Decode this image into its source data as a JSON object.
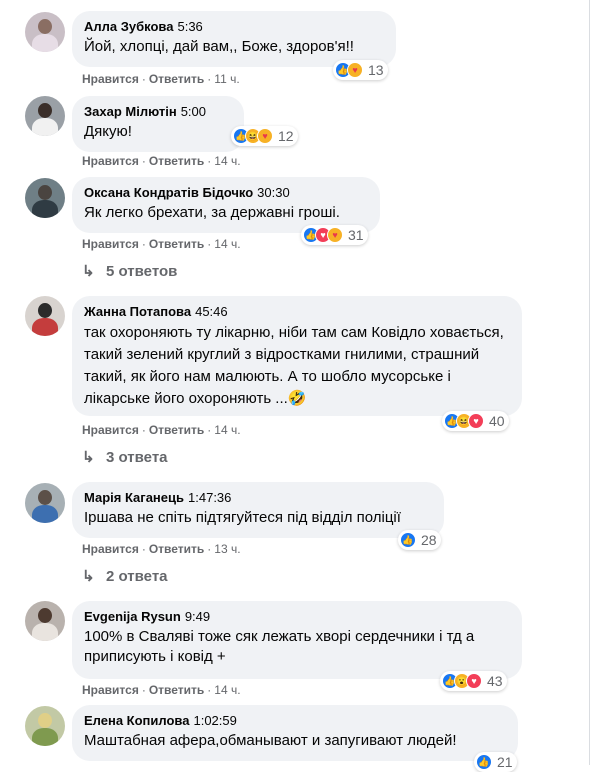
{
  "labels": {
    "like": "Нравится",
    "reply": "Ответить",
    "sep": "·"
  },
  "colors": {
    "bubble": "#f0f2f5",
    "muted": "#65676b",
    "like_blue": "#1877f2"
  },
  "comments": [
    {
      "author": "Алла Зубкова",
      "time": "5:36",
      "text": "Йой, хлопці, дай вам,, Боже, здоров'я!!",
      "age": "11 ч.",
      "reactions": [
        "like-icon",
        "care-icon"
      ],
      "reaction_count": "13"
    },
    {
      "author": "Захар Мілютін",
      "time": "5:00",
      "text": "Дякую!",
      "age": "14 ч.",
      "reactions": [
        "like-icon",
        "haha-icon",
        "care-icon"
      ],
      "reaction_count": "12"
    },
    {
      "author": "Оксана Кондратів Бідочко",
      "time": "30:30",
      "text": "Як легко брехати, за державні гроші.",
      "age": "14 ч.",
      "reactions": [
        "like-icon",
        "love-icon",
        "care-icon"
      ],
      "reaction_count": "31",
      "replies": "5 ответов"
    },
    {
      "author": "Жанна Потапова",
      "time": "45:46",
      "text": "так охороняють ту лікарню, ніби там сам Ковідло ховається, такий зелений круглий з відростками гнилими, страшний такий, як його нам малюють. А то шобло мусорське і лікарське його охороняють ...🤣",
      "age": "14 ч.",
      "reactions": [
        "like-icon",
        "haha-icon",
        "love-icon"
      ],
      "reaction_count": "40",
      "replies": "3 ответа"
    },
    {
      "author": "Марія Каганець",
      "time": "1:47:36",
      "text": "Іршава не спіть підтягуйтеся під відділ поліції",
      "age": "13 ч.",
      "reactions": [
        "like-icon"
      ],
      "reaction_count": "28",
      "replies": "2 ответа"
    },
    {
      "author": "Evgenija Rysun",
      "time": "9:49",
      "text": "100% в Свалявi тоже сяк лежать хворi сердечники i тд а приписують i ковiд +",
      "age": "14 ч.",
      "reactions": [
        "like-icon",
        "wow-icon",
        "love-icon"
      ],
      "reaction_count": "43"
    },
    {
      "author": "Елена Копилова",
      "time": "1:02:59",
      "text": "Маштабная афера,обманывают и запугивают людей!",
      "reactions": [
        "like-icon"
      ],
      "reaction_count": "21"
    }
  ]
}
